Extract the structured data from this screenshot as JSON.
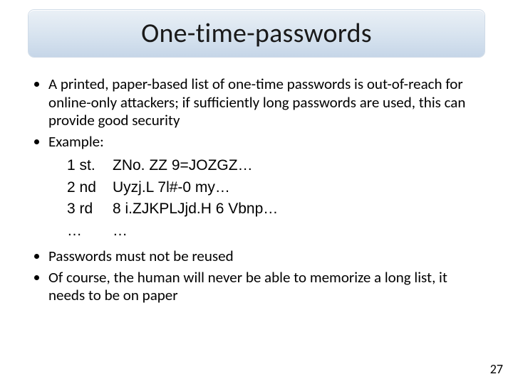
{
  "title": "One-time-passwords",
  "bullets": {
    "b1": "A printed, paper-based list of one-time passwords is out-of-reach for online-only attackers; if sufficiently long passwords are used, this can provide good security",
    "b2": "Example:",
    "b3": "Passwords must not be reused",
    "b4": "Of course, the human will never be able to memorize a long list, it needs to be on paper"
  },
  "examples": [
    {
      "label": "1 st.",
      "value": "ZNo. ZZ 9=JOZGZ…"
    },
    {
      "label": "2 nd",
      "value": "Uyzj.L 7l#-0 my…"
    },
    {
      "label": "3 rd",
      "value": "8 i.ZJKPLJjd.H 6 Vbnp…"
    },
    {
      "label": "…",
      "value": "…"
    }
  ],
  "page_number": "27"
}
